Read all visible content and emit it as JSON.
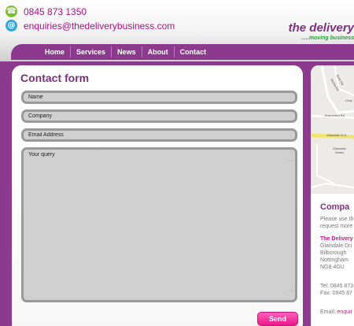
{
  "header": {
    "phone": "0845 873 1350",
    "email": "enquiries@thedeliverybusiness.com",
    "phone_icon": "phone-icon",
    "email_icon": "email-icon",
    "phone_glyph": "☎",
    "email_glyph": "@",
    "logo_name": "the delivery",
    "logo_tagline": ".....moving business"
  },
  "nav": {
    "items": [
      "Home",
      "Services",
      "News",
      "About",
      "Contact"
    ]
  },
  "form": {
    "title": "Contact form",
    "name_placeholder": "Name",
    "company_placeholder": "Company",
    "email_placeholder": "Email Address",
    "query_placeholder": "Your query",
    "send_label": "Send"
  },
  "map": {
    "labels": {
      "road1": "Nicola Rd",
      "road2": "Brett Rd",
      "road3": "Gray",
      "road4": "Bramerton Rd",
      "road5": "Glaisdale Dr E",
      "works1": "Glaisdale",
      "works2": "Works"
    }
  },
  "company": {
    "heading": "Compa",
    "intro_line1": "Please use th",
    "intro_line2": "request more",
    "name": "The Delivery",
    "address": [
      "Glaisdale Dri",
      "Bilborough",
      "Nottingham",
      "NG8 4GU"
    ],
    "tel": "Tel: 0845 873",
    "fax": "Fax: 0845 87",
    "email_label": "Email:",
    "email_value": "enquir"
  },
  "colors": {
    "brand_purple": "#8c3a8e",
    "title_purple": "#7d2f7f",
    "pink_accent": "#d4147f",
    "send_button": "#e8198b",
    "green_tagline": "#2f9c3c"
  }
}
